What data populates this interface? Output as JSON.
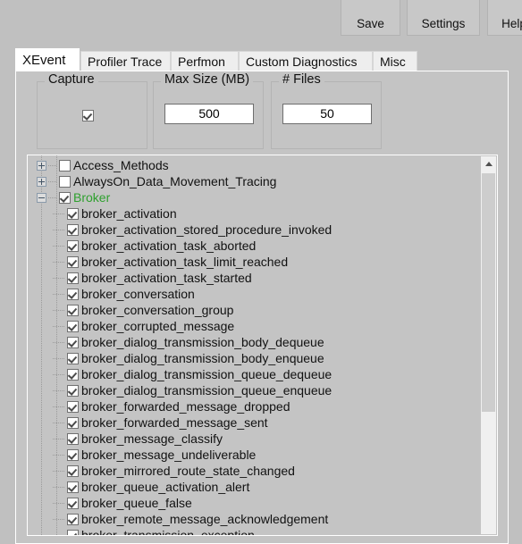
{
  "toolbar": {
    "buttons": [
      {
        "label": "Save",
        "name": "save-button"
      },
      {
        "label": "Settings",
        "name": "settings-button"
      },
      {
        "label": "Help",
        "name": "help-button"
      }
    ]
  },
  "tabs": [
    {
      "label": "XEvent",
      "selected": true
    },
    {
      "label": "Profiler Trace",
      "selected": false
    },
    {
      "label": "Perfmon",
      "selected": false
    },
    {
      "label": "Custom Diagnostics",
      "selected": false
    },
    {
      "label": "Misc",
      "selected": false
    }
  ],
  "groups": {
    "capture": {
      "title": "Capture",
      "checked": true
    },
    "max_size": {
      "title": "Max Size (MB)",
      "value": "500"
    },
    "num_files": {
      "title": "# Files",
      "value": "50"
    }
  },
  "colors": {
    "window_background": "#c0c0c0",
    "panel_background": "#c4c4c4",
    "selected_tab": "#ffffff",
    "tab_background": "#eeeeee",
    "selected_node_text": "#2ea02e",
    "scroll_thumb": "#cdcdcd"
  },
  "tree": {
    "nodes": [
      {
        "label": "Access_Methods",
        "level": 0,
        "checked": false,
        "expanded": false,
        "green": false
      },
      {
        "label": "AlwaysOn_Data_Movement_Tracing",
        "level": 0,
        "checked": false,
        "expanded": false,
        "green": false
      },
      {
        "label": "Broker",
        "level": 0,
        "checked": true,
        "expanded": true,
        "green": true
      },
      {
        "label": "broker_activation",
        "level": 1,
        "checked": true,
        "green": false
      },
      {
        "label": "broker_activation_stored_procedure_invoked",
        "level": 1,
        "checked": true,
        "green": false
      },
      {
        "label": "broker_activation_task_aborted",
        "level": 1,
        "checked": true,
        "green": false
      },
      {
        "label": "broker_activation_task_limit_reached",
        "level": 1,
        "checked": true,
        "green": false
      },
      {
        "label": "broker_activation_task_started",
        "level": 1,
        "checked": true,
        "green": false
      },
      {
        "label": "broker_conversation",
        "level": 1,
        "checked": true,
        "green": false
      },
      {
        "label": "broker_conversation_group",
        "level": 1,
        "checked": true,
        "green": false
      },
      {
        "label": "broker_corrupted_message",
        "level": 1,
        "checked": true,
        "green": false
      },
      {
        "label": "broker_dialog_transmission_body_dequeue",
        "level": 1,
        "checked": true,
        "green": false
      },
      {
        "label": "broker_dialog_transmission_body_enqueue",
        "level": 1,
        "checked": true,
        "green": false
      },
      {
        "label": "broker_dialog_transmission_queue_dequeue",
        "level": 1,
        "checked": true,
        "green": false
      },
      {
        "label": "broker_dialog_transmission_queue_enqueue",
        "level": 1,
        "checked": true,
        "green": false
      },
      {
        "label": "broker_forwarded_message_dropped",
        "level": 1,
        "checked": true,
        "green": false
      },
      {
        "label": "broker_forwarded_message_sent",
        "level": 1,
        "checked": true,
        "green": false
      },
      {
        "label": "broker_message_classify",
        "level": 1,
        "checked": true,
        "green": false
      },
      {
        "label": "broker_message_undeliverable",
        "level": 1,
        "checked": true,
        "green": false
      },
      {
        "label": "broker_mirrored_route_state_changed",
        "level": 1,
        "checked": true,
        "green": false
      },
      {
        "label": "broker_queue_activation_alert",
        "level": 1,
        "checked": true,
        "green": false
      },
      {
        "label": "broker_queue_false",
        "level": 1,
        "checked": true,
        "green": false
      },
      {
        "label": "broker_remote_message_acknowledgement",
        "level": 1,
        "checked": true,
        "green": false
      },
      {
        "label": "broker_transmission_exception",
        "level": 1,
        "checked": true,
        "green": false
      }
    ]
  },
  "scrollbar": {
    "up_arrow_icon": "chevron-up-icon"
  }
}
